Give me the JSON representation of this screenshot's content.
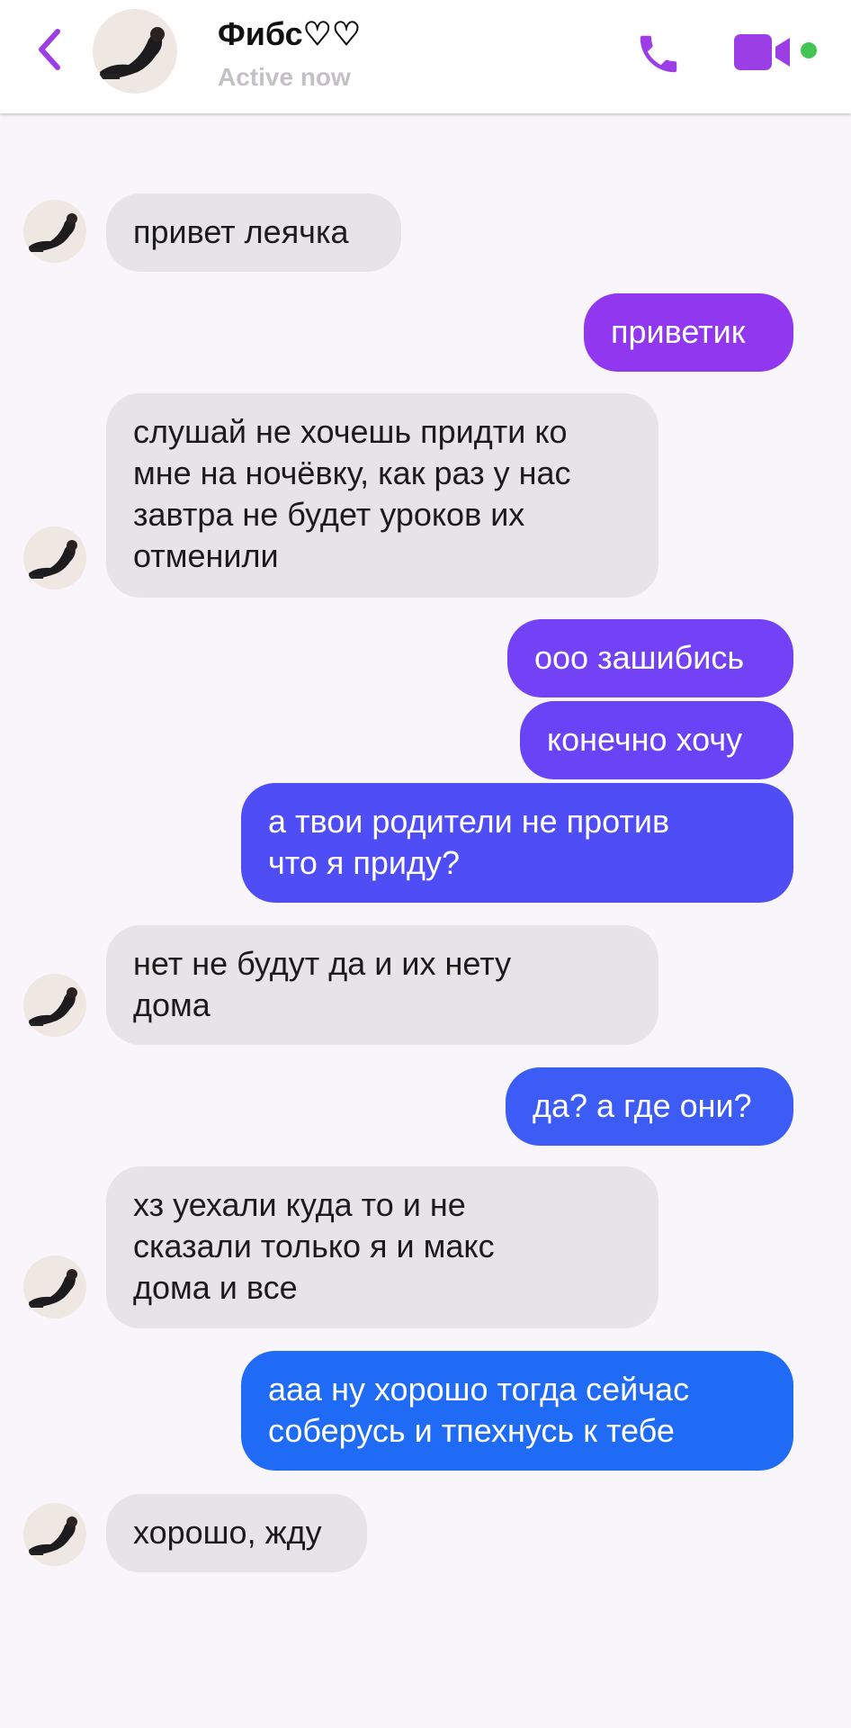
{
  "header": {
    "contact_name": "Фибс♡♡",
    "status": "Active now"
  },
  "colors": {
    "accent_purple": "#9b3ee6",
    "incoming_bubble": "#e6e4e8",
    "online_dot": "#44c553"
  },
  "icons": [
    "chevron-left-icon",
    "phone-icon",
    "video-camera-icon"
  ],
  "messages": [
    {
      "sender": "them",
      "lines": [
        "привет леячка"
      ]
    },
    {
      "sender": "me",
      "lines": [
        "приветик"
      ],
      "color": "#9137f0"
    },
    {
      "sender": "them",
      "lines": [
        "слушай не хочешь придти ко",
        "мне на ночёвку, как раз у нас",
        "завтра не будет уроков их",
        "отменили"
      ]
    },
    {
      "sender": "me",
      "lines": [
        "ооо зашибись"
      ],
      "color": "#7341f6"
    },
    {
      "sender": "me",
      "lines": [
        "конечно хочу"
      ],
      "color": "#6844f6"
    },
    {
      "sender": "me",
      "lines": [
        "а твои родители не против",
        "что я приду?"
      ],
      "color": "#4f4df6"
    },
    {
      "sender": "them",
      "lines": [
        "нет не будут да и их нету",
        "дома"
      ]
    },
    {
      "sender": "me",
      "lines": [
        "да? а где они?"
      ],
      "color": "#3d5cf6"
    },
    {
      "sender": "them",
      "lines": [
        "хз уехали куда то и не",
        "сказали только я и макс",
        "дома и все"
      ]
    },
    {
      "sender": "me",
      "lines": [
        "ааа ну хорошо  тогда сейчас",
        "соберусь  и тпехнусь к тебе"
      ],
      "color": "#1f6bf6"
    },
    {
      "sender": "them",
      "lines": [
        "хорошо, жду"
      ]
    }
  ]
}
